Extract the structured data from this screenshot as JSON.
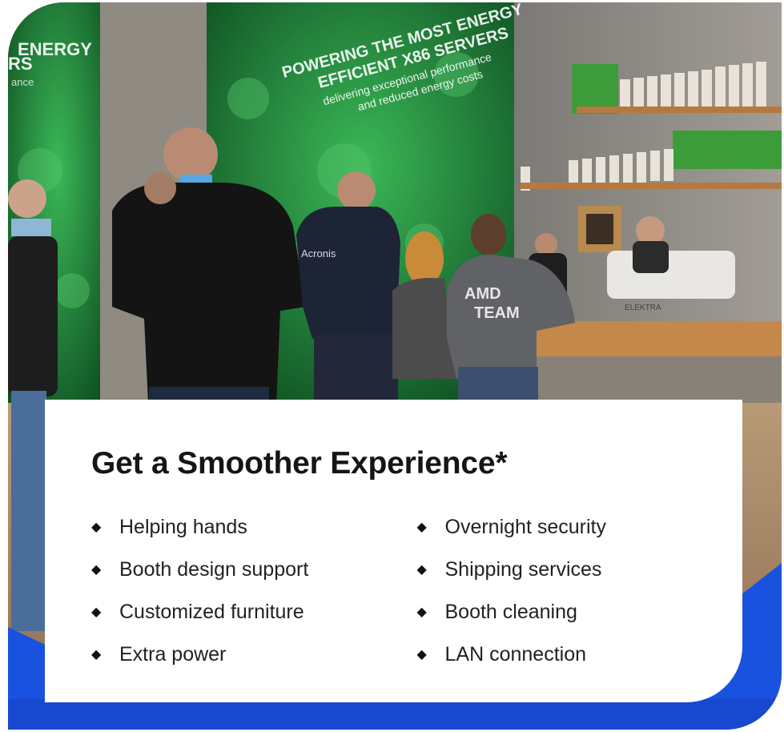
{
  "photo": {
    "screen_text": [
      "ENERGY",
      "RS",
      "ance"
    ],
    "wall_text": [
      "POWERING THE MOST ENERGY",
      "EFFICIENT X86 SERVERS",
      "delivering exceptional performance",
      "and reduced energy costs"
    ],
    "shirt_brand": "Acronis",
    "hoodie_text": [
      "AMD",
      "TEAM"
    ],
    "machine_brand": "ELEKTRA"
  },
  "card": {
    "title": "Get a Smoother Experience*",
    "left_items": [
      "Helping hands",
      "Booth design support",
      "Customized furniture",
      "Extra power"
    ],
    "right_items": [
      "Overnight security",
      "Shipping services",
      "Booth cleaning",
      "LAN connection"
    ],
    "bullet_icon": "diamond-bullet-icon"
  },
  "colors": {
    "frame_blue": "#1a52e0",
    "card_bg": "#ffffff",
    "title": "#151515",
    "moss_green": "#2fa04a"
  }
}
